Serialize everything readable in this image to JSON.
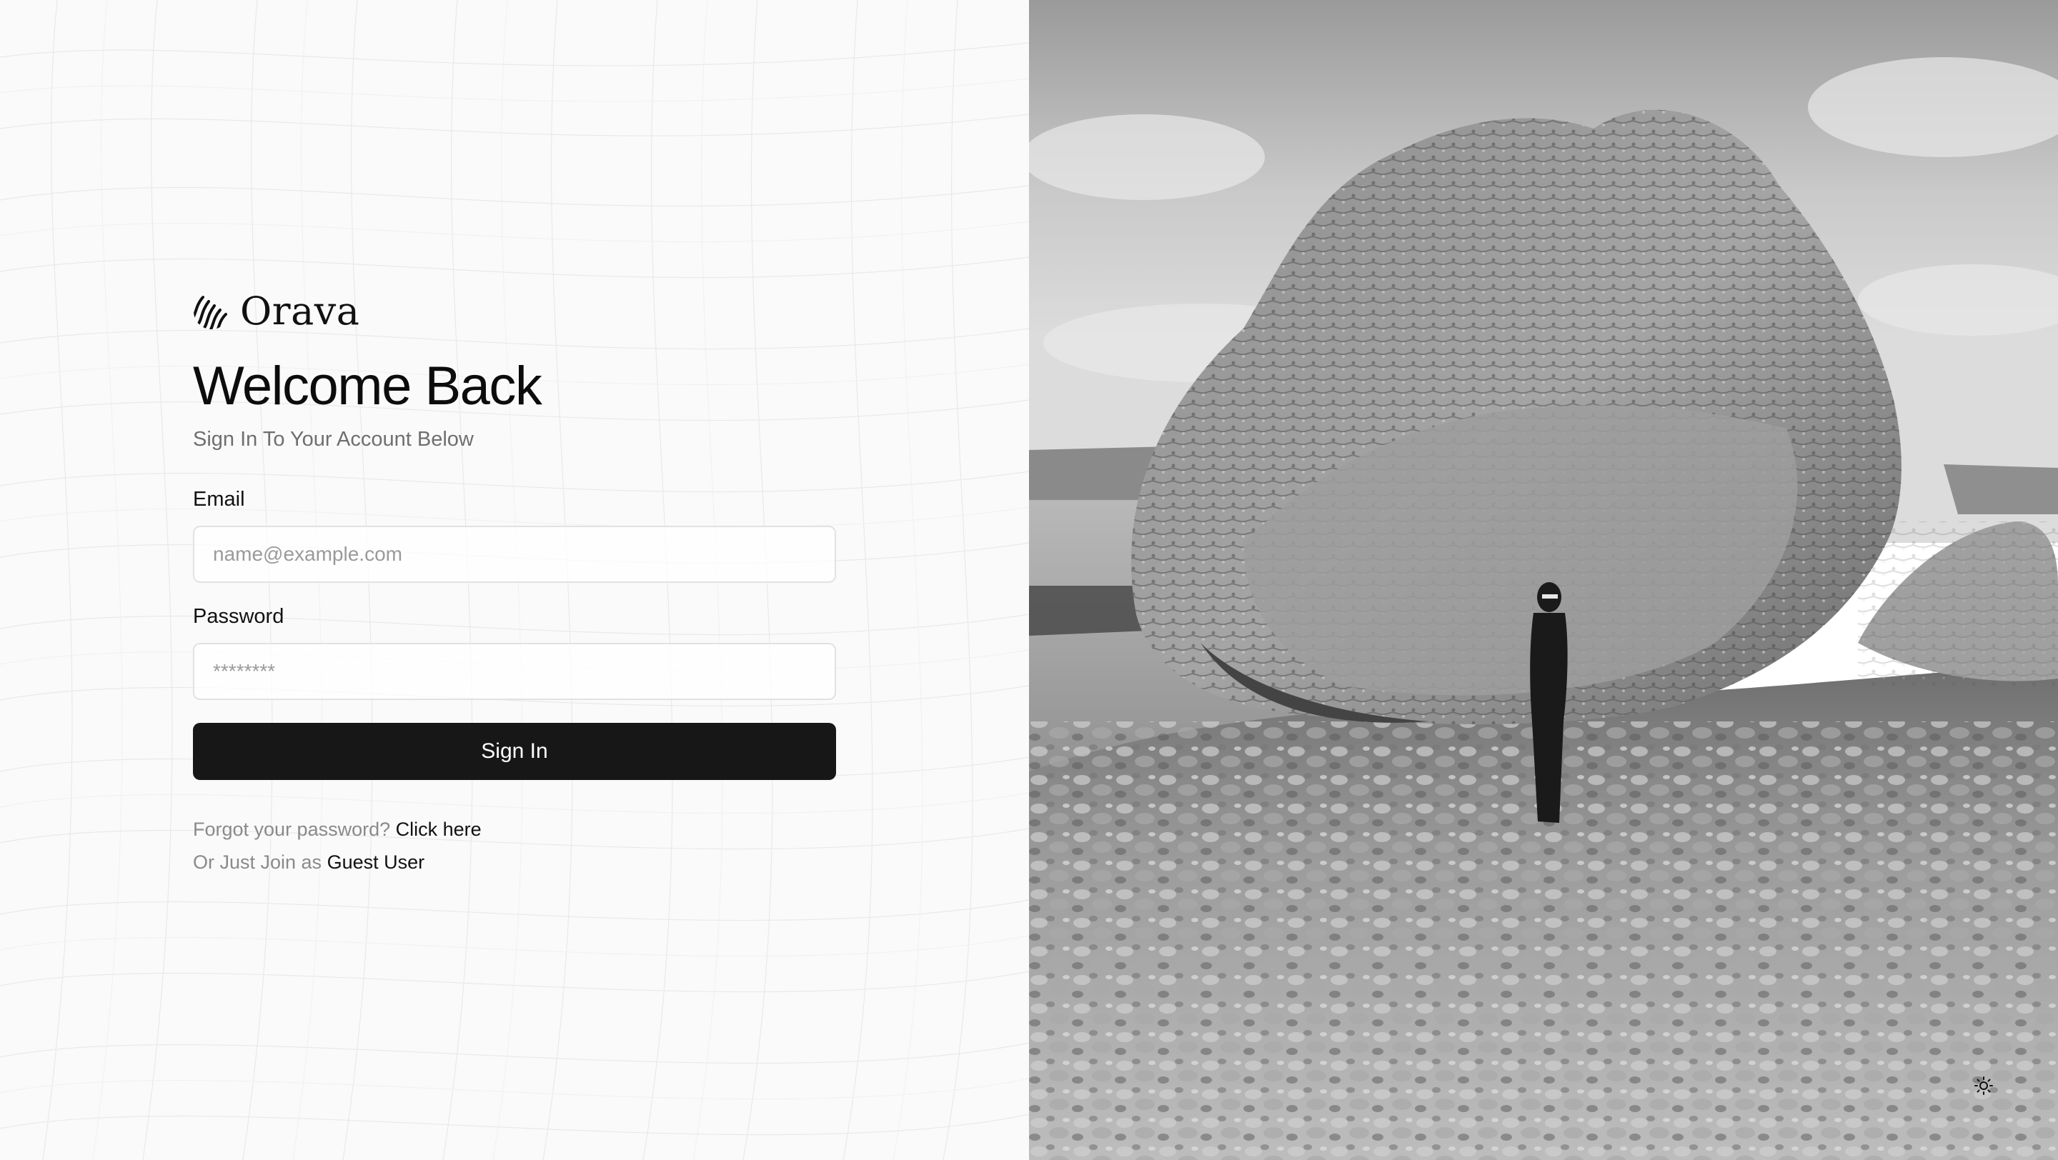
{
  "brand": {
    "name": "Orava",
    "logo_icon": "orava-logo-icon"
  },
  "form": {
    "title": "Welcome Back",
    "subtitle": "Sign In To Your Account Below",
    "email_label": "Email",
    "email_placeholder": "name@example.com",
    "email_value": "",
    "password_label": "Password",
    "password_placeholder": "********",
    "password_value": "",
    "submit_label": "Sign In"
  },
  "links": {
    "forgot_text": "Forgot your password?",
    "forgot_link": "Click here",
    "guest_text": "Or Just Join as",
    "guest_link": "Guest User"
  },
  "hero": {
    "image_icon": "monochrome-landscape-photo",
    "theme_toggle_icon": "sun-icon"
  },
  "colors": {
    "button_bg": "#171717",
    "button_text": "#ffffff",
    "muted_text": "#6f6f6f",
    "input_border": "#e2e2e2"
  }
}
